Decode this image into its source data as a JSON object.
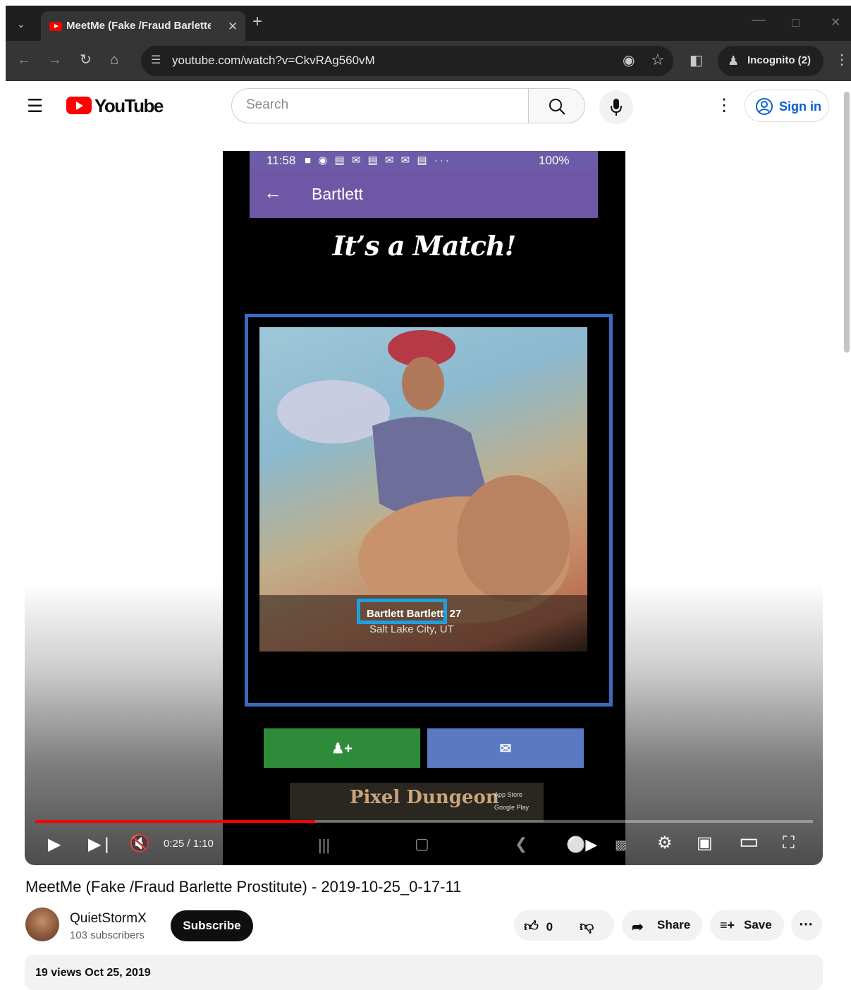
{
  "browser": {
    "tab_title": "MeetMe (Fake /Fraud Barlette",
    "new_tab": "+",
    "url": "youtube.com/watch?v=CkvRAg560vM",
    "incognito_label": "Incognito (2)"
  },
  "youtube": {
    "logo_text": "YouTube",
    "search_placeholder": "Search",
    "signin_label": "Sign in"
  },
  "phone": {
    "status_time": "11:58",
    "status_battery": "100%",
    "appbar_title": "Bartlett",
    "match_text": "It’s a Match!",
    "profile_name": "Bartlett Bartlett",
    "profile_age": "27",
    "profile_location": "Salt Lake City, UT",
    "ad_text": "Pixel Dungeon",
    "store_1": "App Store",
    "store_2": "Google Play"
  },
  "player": {
    "time": "0:25 / 1:10",
    "progress": 0.36
  },
  "video": {
    "title": "MeetMe (Fake /Fraud Barlette Prostitute) - 2019-10-25_0-17-11",
    "channel": "QuietStormX",
    "subscribers": "103 subscribers",
    "subscribe_label": "Subscribe",
    "likes": "0",
    "share_label": "Share",
    "save_label": "Save",
    "views_date": "19 views  Oct 25, 2019"
  }
}
